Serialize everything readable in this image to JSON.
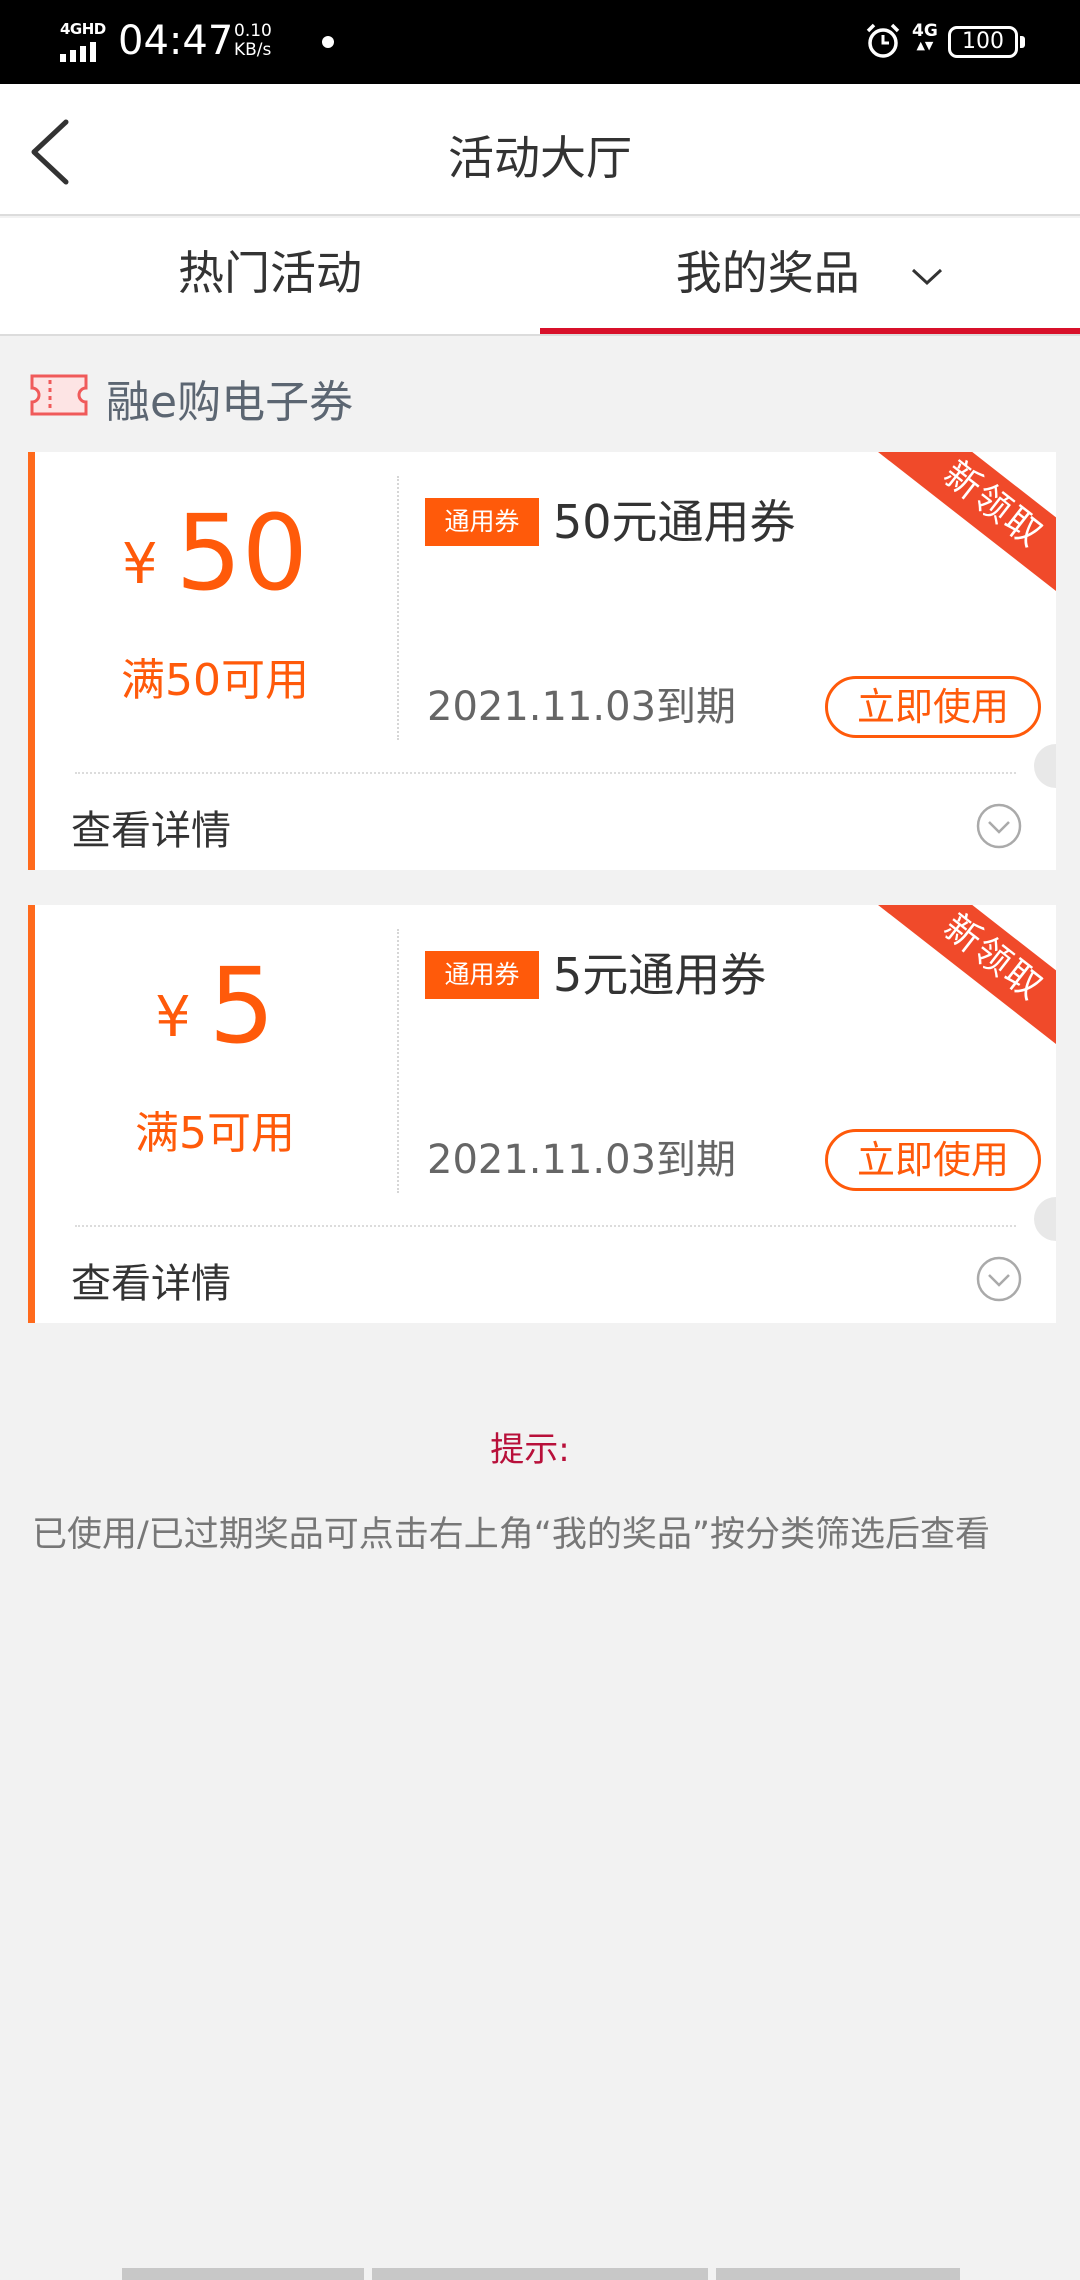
{
  "status_bar": {
    "network": "4GHD",
    "time": "04:47",
    "speed_value": "0.10",
    "speed_unit": "KB/s",
    "net_type": "4G",
    "battery": "100"
  },
  "nav": {
    "title": "活动大厅"
  },
  "tabs": [
    {
      "label": "热门活动",
      "active": false
    },
    {
      "label": "我的奖品",
      "active": true
    }
  ],
  "section": {
    "title": "融e购电子券"
  },
  "coupons": [
    {
      "currency": "¥",
      "amount": "50",
      "threshold": "满50可用",
      "type": "通用券",
      "name": "50元通用券",
      "expire": "2021.11.03到期",
      "action": "立即使用",
      "ribbon": "新领取",
      "details": "查看详情"
    },
    {
      "currency": "¥",
      "amount": "5",
      "threshold": "满5可用",
      "type": "通用券",
      "name": "5元通用券",
      "expire": "2021.11.03到期",
      "action": "立即使用",
      "ribbon": "新领取",
      "details": "查看详情"
    }
  ],
  "hint": {
    "title": "提示:",
    "text": "已使用/已过期奖品可点击右上角“我的奖品”按分类筛选后查看"
  },
  "colors": {
    "accent": "#ff5a0a",
    "tab_underline": "#d8102a",
    "hint_title": "#b8103a",
    "ribbon": "#f04a2a"
  }
}
